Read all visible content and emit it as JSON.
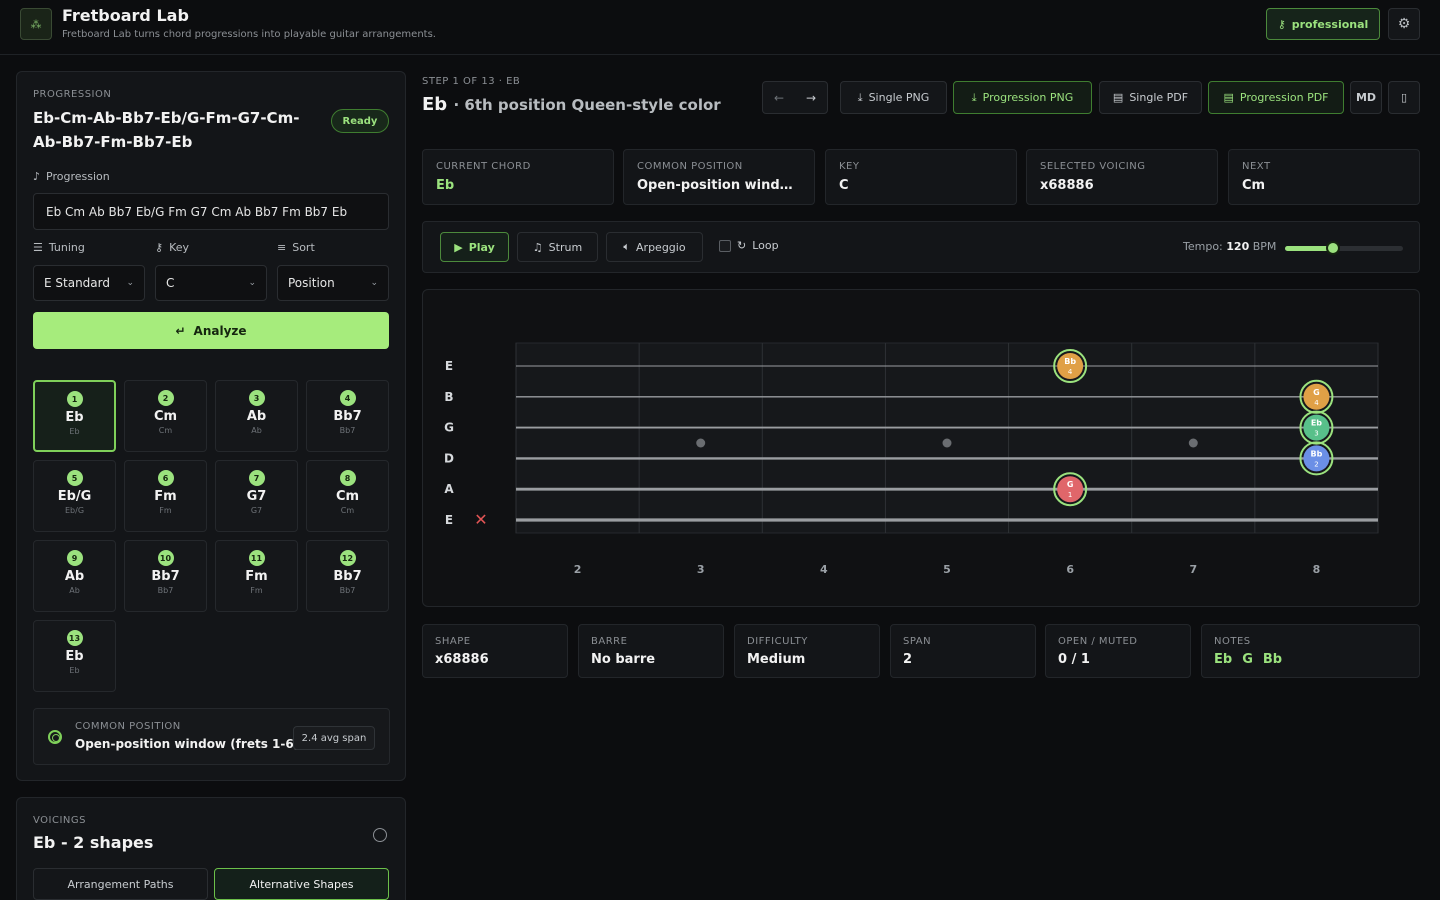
{
  "app": {
    "title": "Fretboard Lab",
    "subtitle": "Fretboard Lab turns chord progressions into playable guitar arrangements.",
    "pro_label": "professional"
  },
  "progression_panel": {
    "label": "PROGRESSION",
    "title": "Eb-Cm-Ab-Bb7-Eb/G-Fm-G7-Cm-Ab-Bb7-Fm-Bb7-Eb",
    "status": "Ready",
    "progression_label": "Progression",
    "progression_value": "Eb Cm Ab Bb7 Eb/G Fm G7 Cm Ab Bb7 Fm Bb7 Eb",
    "tuning_label": "Tuning",
    "tuning_value": "E Standard",
    "key_label": "Key",
    "key_value": "C",
    "sort_label": "Sort",
    "sort_value": "Position",
    "analyze_label": "Analyze"
  },
  "chords": [
    {
      "num": "1",
      "name": "Eb",
      "sub": "Eb"
    },
    {
      "num": "2",
      "name": "Cm",
      "sub": "Cm"
    },
    {
      "num": "3",
      "name": "Ab",
      "sub": "Ab"
    },
    {
      "num": "4",
      "name": "Bb7",
      "sub": "Bb7"
    },
    {
      "num": "5",
      "name": "Eb/G",
      "sub": "Eb/G"
    },
    {
      "num": "6",
      "name": "Fm",
      "sub": "Fm"
    },
    {
      "num": "7",
      "name": "G7",
      "sub": "G7"
    },
    {
      "num": "8",
      "name": "Cm",
      "sub": "Cm"
    },
    {
      "num": "9",
      "name": "Ab",
      "sub": "Ab"
    },
    {
      "num": "10",
      "name": "Bb7",
      "sub": "Bb7"
    },
    {
      "num": "11",
      "name": "Fm",
      "sub": "Fm"
    },
    {
      "num": "12",
      "name": "Bb7",
      "sub": "Bb7"
    },
    {
      "num": "13",
      "name": "Eb",
      "sub": "Eb"
    }
  ],
  "common_position": {
    "label": "COMMON POSITION",
    "value": "Open-position window (frets 1-6)",
    "span": "2.4 avg span"
  },
  "voicings": {
    "label": "VOICINGS",
    "title": "Eb - 2 shapes",
    "tab_paths": "Arrangement Paths",
    "tab_alt": "Alternative Shapes"
  },
  "main": {
    "step": "STEP 1 OF 13 · EB",
    "chord": "Eb",
    "description": "6th position Queen-style color",
    "buttons": {
      "single_png": "Single PNG",
      "progression_png": "Progression PNG",
      "single_pdf": "Single PDF",
      "progression_pdf": "Progression PDF",
      "md": "MD"
    }
  },
  "stats": [
    {
      "k": "CURRENT CHORD",
      "v": "Eb",
      "accent": true
    },
    {
      "k": "COMMON POSITION",
      "v": "Open-position windo..."
    },
    {
      "k": "KEY",
      "v": "C"
    },
    {
      "k": "SELECTED VOICING",
      "v": "x68886"
    },
    {
      "k": "NEXT",
      "v": "Cm"
    }
  ],
  "playback": {
    "play": "Play",
    "strum": "Strum",
    "arpeggio": "Arpeggio",
    "loop": "Loop",
    "tempo_label": "Tempo:",
    "tempo_value": "120",
    "tempo_unit": "BPM",
    "tempo_fraction": 0.41
  },
  "fretboard": {
    "strings": [
      "E",
      "B",
      "G",
      "D",
      "A",
      "E"
    ],
    "fret_numbers": [
      "2",
      "3",
      "4",
      "5",
      "6",
      "7",
      "8"
    ],
    "muted_string": "E",
    "notes": [
      {
        "string": "E",
        "fret": "6",
        "note": "Bb",
        "finger": "4",
        "color": "#e0a046"
      },
      {
        "string": "B",
        "fret": "8",
        "note": "G",
        "finger": "4",
        "color": "#e0a046"
      },
      {
        "string": "G",
        "fret": "8",
        "note": "Eb",
        "finger": "3",
        "color": "#58c08a"
      },
      {
        "string": "D",
        "fret": "8",
        "note": "Bb",
        "finger": "2",
        "color": "#6b8fe6"
      },
      {
        "string": "A",
        "fret": "6",
        "note": "G",
        "finger": "1",
        "color": "#e0666a"
      }
    ]
  },
  "shape_info": [
    {
      "k": "SHAPE",
      "v": "x68886"
    },
    {
      "k": "BARRE",
      "v": "No barre"
    },
    {
      "k": "DIFFICULTY",
      "v": "Medium"
    },
    {
      "k": "SPAN",
      "v": "2"
    },
    {
      "k": "OPEN / MUTED",
      "v": "0 / 1"
    }
  ],
  "notes_info": {
    "k": "NOTES",
    "notes": [
      "Eb",
      "G",
      "Bb"
    ]
  }
}
